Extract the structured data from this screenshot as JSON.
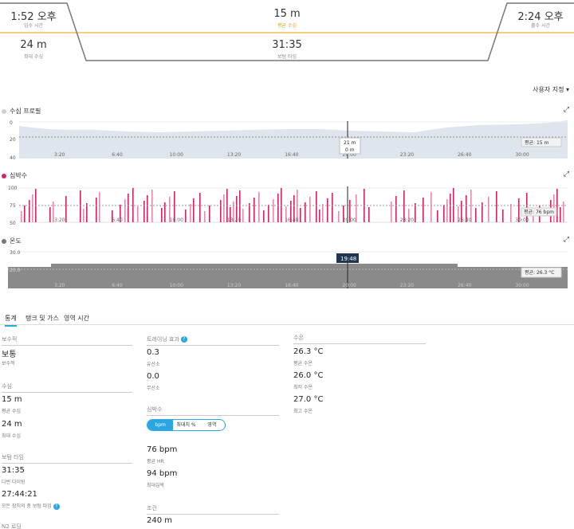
{
  "summary": {
    "start_time": "1:52 오후",
    "start_label": "입수 시간",
    "avg_depth": "15 m",
    "avg_depth_label": "평균 수심",
    "end_time": "2:24 오후",
    "end_label": "출수 시간",
    "max_depth": "24 m",
    "max_depth_label": "최대 수심",
    "bottom_time": "31:35",
    "bottom_time_label": "보텀 타임"
  },
  "customize": "사용자 지정 ▾",
  "charts": {
    "x_ticks": [
      "3:20",
      "6:40",
      "10:00",
      "13:20",
      "16:40",
      "20:00",
      "23:20",
      "26:40",
      "30:00"
    ],
    "depth": {
      "title": "수심 프로필",
      "yticks": [
        "0",
        "20",
        "40"
      ],
      "avg_label": "평균: 15 m",
      "tooltip_line1": "21 m",
      "tooltip_line2": "0 m",
      "color": "#dde3ea"
    },
    "hr": {
      "title": "심박수",
      "yticks": [
        "100",
        "75",
        "50"
      ],
      "avg_label": "평균: 76 bpm",
      "color": "#d6245c"
    },
    "temp": {
      "title": "온도",
      "yticks": [
        "30.0",
        "20.0"
      ],
      "avg_label": "평균: 26.3 °C",
      "cursor_label": "19:48",
      "color": "#8a8a8a"
    }
  },
  "tabs": [
    "통계",
    "탱크 및 가스",
    "영역 시간"
  ],
  "stats": {
    "conservatism": {
      "title": "보수적",
      "value": "보통",
      "label": "보수적"
    },
    "depth": {
      "title": "수심",
      "avg": "15 m",
      "avg_label": "평균 수심",
      "max": "24 m",
      "max_label": "최대 수심"
    },
    "bottom": {
      "title": "보텀 타임",
      "v1": "31:35",
      "l1": "다번 다이빙",
      "v2": "27:44:21",
      "l2": "모든 장치의 총 보텀 타임"
    },
    "n2": {
      "title": "N2 로딩"
    },
    "training": {
      "title": "트레이닝 효과",
      "v1": "0.3",
      "l1": "유산소",
      "v2": "0.0",
      "l2": "무산소"
    },
    "hr": {
      "title": "심박수",
      "seg": [
        "bpm",
        "최대치 %",
        "영역"
      ],
      "avg": "76 bpm",
      "avg_label": "평균 HR",
      "max": "94 bpm",
      "max_label": "최대심박"
    },
    "distance": {
      "title": "조건",
      "value": "240 m"
    },
    "temp": {
      "title": "수온",
      "avg": "26.3 °C",
      "avg_label": "평균 수온",
      "min": "26.0 °C",
      "min_label": "최저 수온",
      "max": "27.0 °C",
      "max_label": "최고 수온"
    }
  }
}
